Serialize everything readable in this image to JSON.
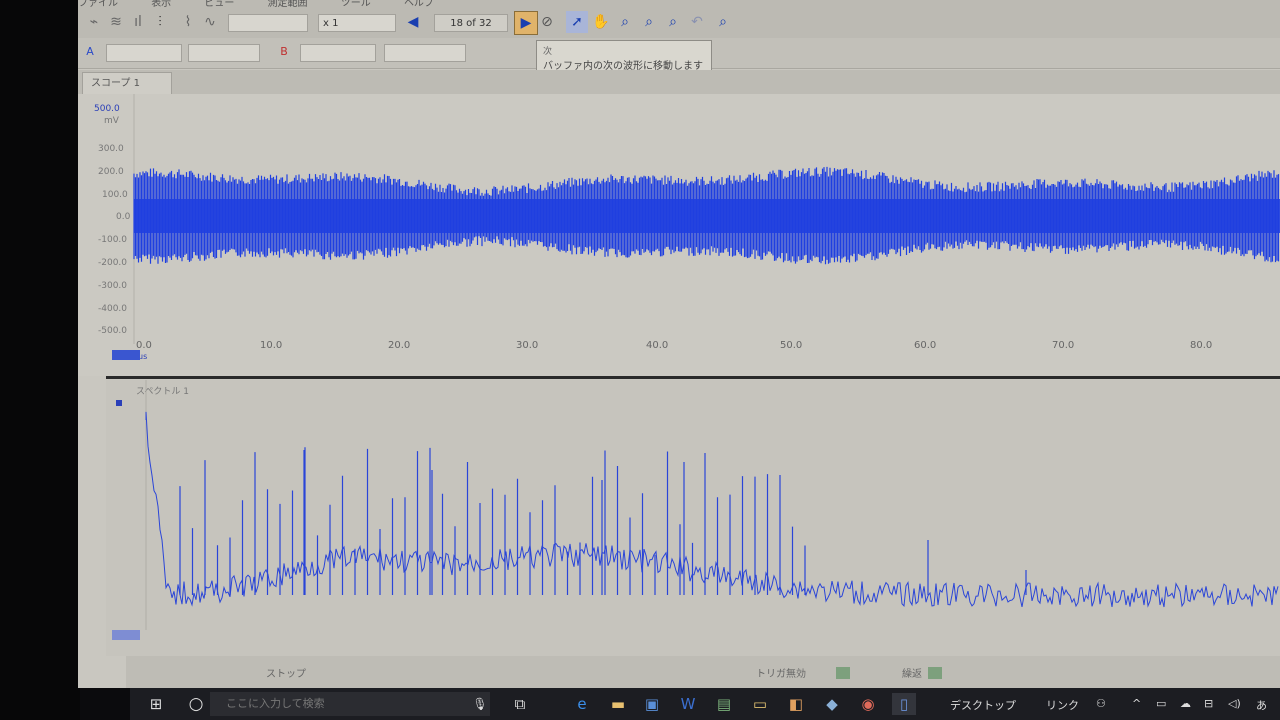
{
  "menu": {
    "items": [
      "ファイル",
      "表示",
      "ビュー",
      "測定範囲",
      "ツール",
      "ヘルプ"
    ]
  },
  "toolbar": {
    "multiplier": "x 1",
    "buffer_position": "18 of 32",
    "tooltip_title": "次",
    "tooltip_text": "バッファ内の次の波形に移動します"
  },
  "tabs": {
    "scope": "スコープ 1"
  },
  "scope": {
    "y_unit": "mV",
    "y_labels": [
      "500.0",
      "300.0",
      "200.0",
      "100.0",
      "0.0",
      "-100.0",
      "-200.0",
      "-300.0",
      "-400.0",
      "-500.0"
    ],
    "x_labels": [
      "0.0",
      "10.0",
      "20.0",
      "30.0",
      "40.0",
      "50.0",
      "60.0",
      "70.0",
      "80.0"
    ],
    "x_unit": "us",
    "trace_color": "#1f3fe0"
  },
  "spectrum": {
    "title": "スペクトル 1",
    "trace_color": "#2a45d8"
  },
  "statusbar": {
    "left": "ストップ",
    "trigger": "トリガ無効",
    "mode": "繰返"
  },
  "taskbar": {
    "search_placeholder": "ここに入力して検索",
    "desktop": "デスクトップ",
    "links": "リンク"
  },
  "colors": {
    "accent": "#1a3fb0",
    "background": "#c9c7c0"
  }
}
